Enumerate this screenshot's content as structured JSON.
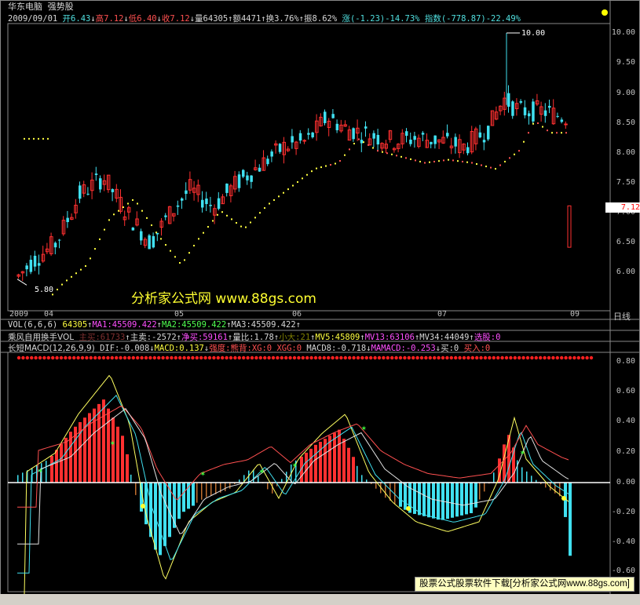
{
  "header": {
    "stock_name": "华东电脑",
    "indicator_name": "强势股",
    "date": "2009/09/01",
    "open_label": "开6.43",
    "high_label": "高7.12",
    "low_label": "低6.40",
    "close_label": "收7.12",
    "volume_label": "量64305",
    "amount_label": "额4471",
    "turnover_label": "换3.76%",
    "amplitude_label": "振8.62%",
    "change_label": "涨(-1.23)-14.73%",
    "index_label": "指数(-778.87)-22.49%"
  },
  "price_axis": {
    "ticks": [
      "10.00",
      "9.50",
      "9.00",
      "8.50",
      "8.00",
      "7.50",
      "7.00",
      "6.50",
      "6.00"
    ],
    "current_price": "7.12",
    "max_label": "10.00",
    "min_label": "5.80"
  },
  "time_axis": {
    "labels": [
      "2009",
      "04",
      "05",
      "06",
      "07",
      "09"
    ],
    "period": "日线"
  },
  "watermark": {
    "text": "分析家公式网 www.88gs.com"
  },
  "vol_line": {
    "name": "VOL(6,6,6)",
    "vol": "64305",
    "ma1": "MA1:45509.422",
    "ma2": "MA2:45509.422",
    "ma3": "MA3:45509.422"
  },
  "turnover_line": {
    "name": "乘风自用换手VOL",
    "active_buy": "主买:61733",
    "active_sell": "主卖:-2572",
    "net_buy": "净买:59161",
    "vol_ratio": "量比:1.78",
    "small_big": "小大:21",
    "mv5": "MV5:45809",
    "mv13": "MV13:63106",
    "mv34": "MV34:44049",
    "pick": "选股:0"
  },
  "macd_line": {
    "name": "长短MACD(12,26,9,9)",
    "dif": "DIF:-0.008",
    "macd": "MACD:0.137",
    "strength": "强度:熊背:XG:0",
    "xgg": "XGG:0",
    "macd8": "MACD8:-0.718",
    "mamacd": "MAMACD:-0.253",
    "buy": "买:0",
    "buy_in": "买入:0"
  },
  "macd_axis": {
    "ticks": [
      "0.80",
      "0.60",
      "0.40",
      "0.20",
      "0.00",
      "-0.20",
      "-0.40",
      "-0.60"
    ]
  },
  "footer": {
    "text": "股票公式股票软件下载[分析家公式网www.88gs.com]"
  },
  "colors": {
    "up": "#ff3030",
    "down": "#40e0f0",
    "background": "#000000"
  }
}
